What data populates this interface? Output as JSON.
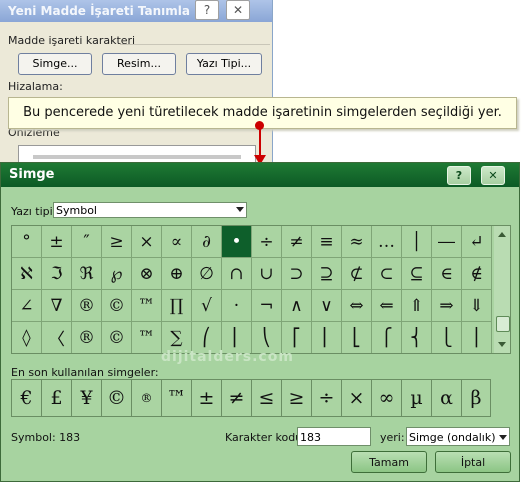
{
  "background_dialog": {
    "title": "Yeni Madde İşareti Tanımla",
    "help": "?",
    "close": "✕",
    "group_label": "Madde işareti karakteri",
    "buttons": {
      "symbol": "Simge...",
      "picture": "Resim...",
      "font": "Yazı Tipi..."
    },
    "alignment_label": "Hizalama:",
    "preview_label": "Önizleme"
  },
  "tooltip": {
    "text": "Bu pencerede yeni türetilecek madde işaretinin simgelerden seçildiği yer."
  },
  "symbol_dialog": {
    "title": "Simge",
    "help": "?",
    "close": "✕",
    "font_label": "Yazı tipi:",
    "font_value": "Symbol",
    "grid": [
      "°",
      "±",
      "″",
      "≥",
      "×",
      "∝",
      "∂",
      "•",
      "÷",
      "≠",
      "≡",
      "≈",
      "…",
      "│",
      "―",
      "↵",
      "ℵ",
      "ℑ",
      "ℜ",
      "℘",
      "⊗",
      "⊕",
      "∅",
      "∩",
      "∪",
      "⊃",
      "⊇",
      "⊄",
      "⊂",
      "⊆",
      "∈",
      "∉",
      "∠",
      "∇",
      "®",
      "©",
      "™",
      "∏",
      "√",
      "·",
      "¬",
      "∧",
      "∨",
      "⇔",
      "⇐",
      "⇑",
      "⇒",
      "⇓",
      "◊",
      "〈",
      "®",
      "©",
      "™",
      "∑",
      "⎛",
      "⎜",
      "⎝",
      "⎡",
      "⎢",
      "⎣",
      "⎧",
      "⎨",
      "⎩",
      "⎪"
    ],
    "selected_index": 7,
    "recent_label": "En son kullanılan simgeler:",
    "recent": [
      "€",
      "£",
      "¥",
      "©",
      "®",
      "™",
      "±",
      "≠",
      "≤",
      "≥",
      "÷",
      "×",
      "∞",
      "µ",
      "α",
      "β"
    ],
    "status": "Symbol: 183",
    "char_code_label": "Karakter kodu:",
    "char_code_value": "183",
    "from_label": "yeri:",
    "from_value": "Simge (ondalık)",
    "ok": "Tamam",
    "cancel": "İptal",
    "watermark": "dijitalders.com"
  }
}
